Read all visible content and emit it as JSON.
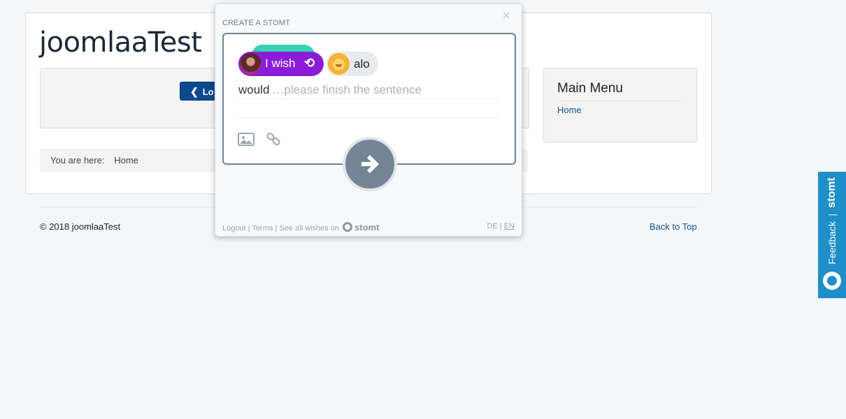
{
  "site": {
    "title": "joomlaaTest",
    "logout_label": "Lo",
    "breadcrumb_prefix": "You are here:",
    "breadcrumb_home": "Home"
  },
  "menu": {
    "title": "Main Menu",
    "items": [
      {
        "label": "Home"
      }
    ]
  },
  "footer": {
    "copyright": "© 2018 joomlaaTest",
    "back_to_top": "Back to Top"
  },
  "feedback_tab": {
    "brand": "stomt",
    "separator": "|",
    "label": "Feedback",
    "color": "#1f8fc9"
  },
  "stomt_popup": {
    "heading": "CREATE A STOMT",
    "close_icon": "×",
    "wish_label": "I wish",
    "wish_color": "#8b1dd8",
    "swap_icon": "⟲",
    "target_name": "alo",
    "sentence_start": "would",
    "placeholder": "…please finish the sentence",
    "icons": [
      "image-icon",
      "link-icon",
      "arrow-right-icon"
    ],
    "footer": {
      "logout": "Logout",
      "sep1": "|",
      "terms": "Terms",
      "sep2": "|",
      "see_all": "See all wishes on",
      "brand": "stomt"
    },
    "lang_de": "DE",
    "lang_sep": "|",
    "lang_en": "EN"
  }
}
